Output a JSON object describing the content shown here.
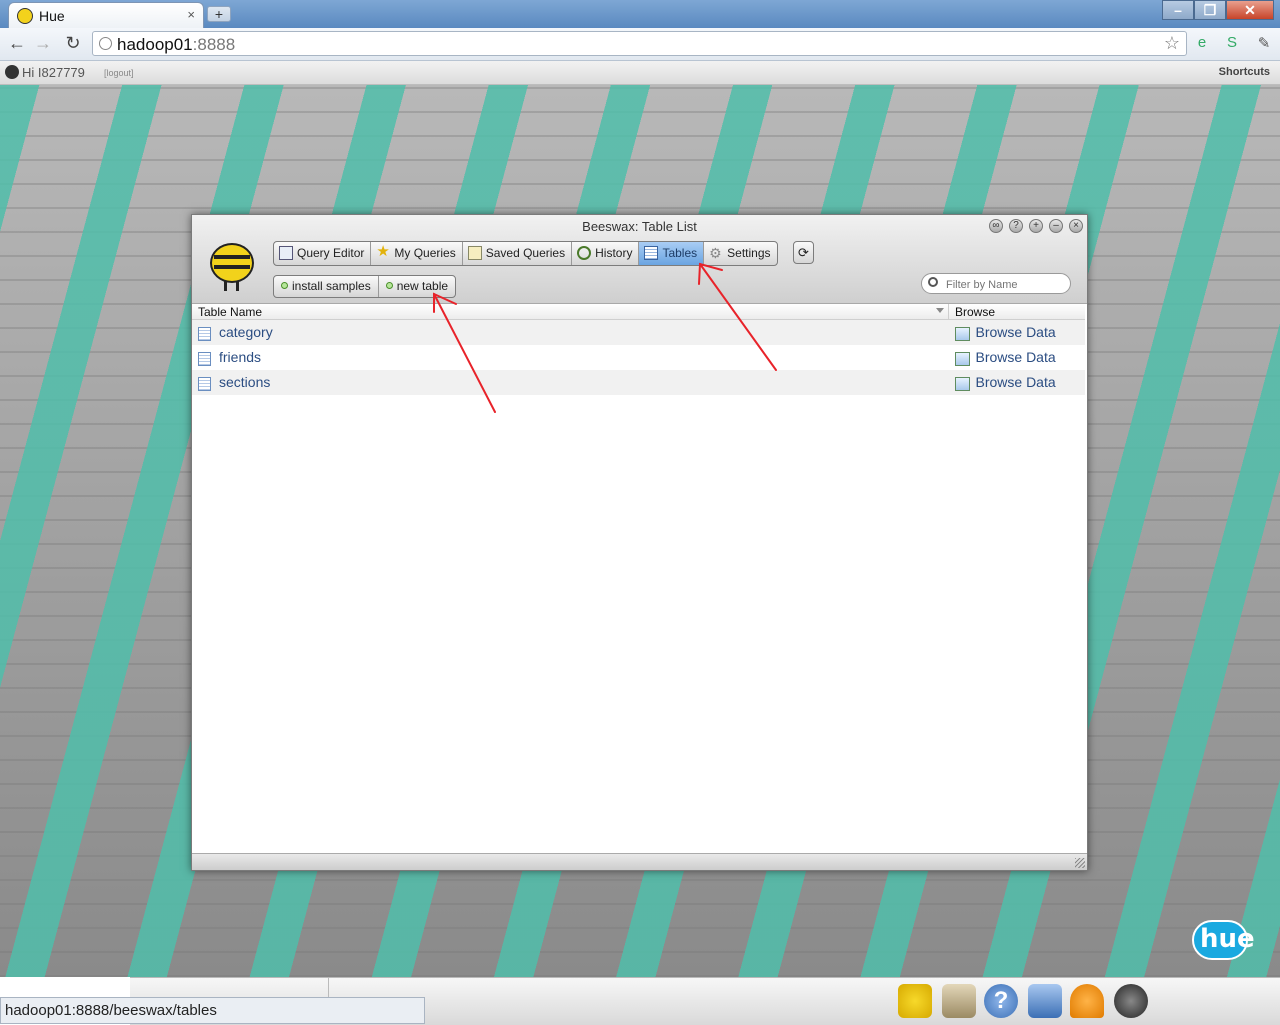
{
  "browser": {
    "tab_title": "Hue",
    "new_tab": "+",
    "tab_close": "×",
    "url_host": "hadoop01",
    "url_port": ":8888",
    "status_url": "hadoop01:8888/beeswax/tables"
  },
  "huebar": {
    "greeting": "Hi I827779",
    "logout": "[logout]",
    "shortcuts": "Shortcuts"
  },
  "window": {
    "title": "Beeswax: Table List",
    "nav": [
      {
        "label": "Query Editor",
        "icon": "query-editor-icon"
      },
      {
        "label": "My Queries",
        "icon": "star-icon"
      },
      {
        "label": "Saved Queries",
        "icon": "saved-queries-icon"
      },
      {
        "label": "History",
        "icon": "clock-icon"
      },
      {
        "label": "Tables",
        "icon": "tables-icon",
        "active": true
      },
      {
        "label": "Settings",
        "icon": "gear-icon"
      }
    ],
    "actions": {
      "install_samples": "install samples",
      "new_table": "new table"
    },
    "filter_placeholder": "Filter by Name",
    "columns": {
      "name": "Table Name",
      "browse": "Browse"
    },
    "rows": [
      {
        "name": "category",
        "browse": "Browse Data"
      },
      {
        "name": "friends",
        "browse": "Browse Data"
      },
      {
        "name": "sections",
        "browse": "Browse Data"
      }
    ]
  },
  "desktop": {
    "hue_logo": "hue"
  },
  "colors": {
    "active_tab": "#6aa4e1",
    "link": "#2b4d82",
    "annotation_arrow": "#e8232a"
  }
}
